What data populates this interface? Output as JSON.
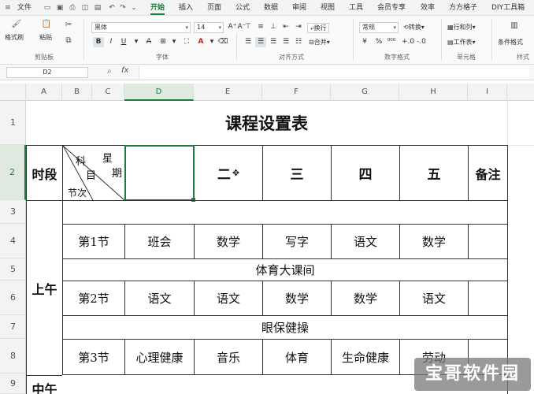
{
  "menubar": {
    "file": "文件",
    "tabs": [
      "开始",
      "插入",
      "页面",
      "公式",
      "数据",
      "审阅",
      "视图",
      "工具",
      "会员专享",
      "效率",
      "方方格子",
      "DIY工具箱"
    ],
    "active_tab": "开始",
    "accent_color": "#1b7a3c"
  },
  "ribbon": {
    "format_painter": "格式刷",
    "paste": "粘贴",
    "clipboard_group": "剪贴板",
    "font_name": "黑体",
    "font_size": "14",
    "font_group": "字体",
    "wrap_text": "换行",
    "merge": "合并",
    "align_group": "对齐方式",
    "number_format": "常规",
    "convert": "转换",
    "number_group": "数字格式",
    "rows_cols": "行和列",
    "worksheet": "工作表",
    "cells_group": "单元格",
    "conditional_format": "条件格式",
    "styles_group": "样式"
  },
  "formula_bar": {
    "name_box": "D2",
    "fx": "fx",
    "formula": ""
  },
  "columns": [
    "A",
    "B",
    "C",
    "D",
    "E",
    "F",
    "G",
    "H",
    "I"
  ],
  "selected_column": "D",
  "rows": [
    "1",
    "2",
    "3",
    "4",
    "5",
    "6",
    "7",
    "8",
    "9"
  ],
  "selected_row": "2",
  "sheet": {
    "title": "课程设置表",
    "header": {
      "period": "时段",
      "diag_xing": "星",
      "diag_qi": "期",
      "diag_ke": "科",
      "diag_mu": "目",
      "diag_jieci": "节次",
      "d2": "",
      "e2": "二",
      "f2": "三",
      "g2": "四",
      "h2": "五",
      "notes": "备注"
    },
    "morning": "上午",
    "noon": "中午",
    "row4": [
      "第1节",
      "班会",
      "数学",
      "写字",
      "语文",
      "数学",
      ""
    ],
    "row5": "体育大课间",
    "row6": [
      "第2节",
      "语文",
      "语文",
      "数学",
      "数学",
      "语文",
      ""
    ],
    "row7": "眼保健操",
    "row8": [
      "第3节",
      "心理健康",
      "音乐",
      "体育",
      "生命健康",
      "劳动",
      ""
    ]
  },
  "watermark": "宝哥软件园"
}
